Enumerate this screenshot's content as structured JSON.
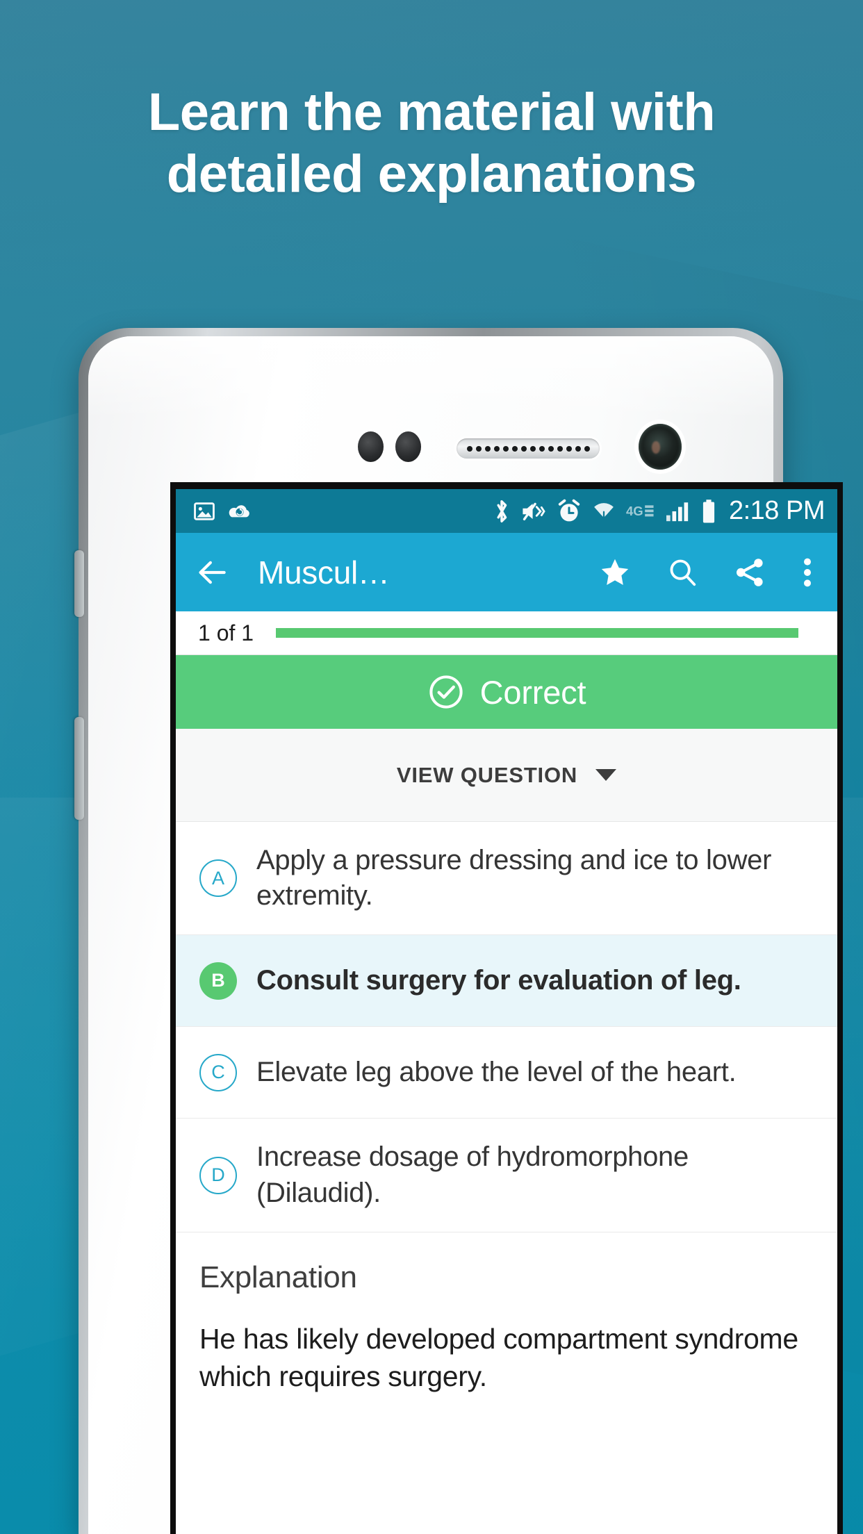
{
  "promo": {
    "headline_line1": "Learn the material with",
    "headline_line2": "detailed explanations",
    "background_color": "#1a7b99"
  },
  "device": {
    "name": "android-phone-mockup",
    "hardware": {
      "earpiece": "earpiece-speaker",
      "front_camera": "front-camera",
      "proximity_sensor": "proximity-sensor",
      "light_sensor": "light-sensor"
    }
  },
  "statusbar": {
    "left_icons": [
      "screenshot-icon",
      "cloud-sync-icon"
    ],
    "right_icons": [
      "bluetooth-icon",
      "volume-mute-icon",
      "alarm-icon",
      "wifi-icon",
      "4glte-icon",
      "signal-bars-icon",
      "battery-icon"
    ],
    "network_label": "4G",
    "time": "2:18 PM",
    "background_color": "#0d7a96"
  },
  "appbar": {
    "back_label": "back-arrow",
    "title": "Muscul…",
    "actions": [
      "star-icon",
      "search-icon",
      "share-icon",
      "overflow-menu-icon"
    ],
    "background_color": "#1ca8d2"
  },
  "progress": {
    "label": "1 of 1",
    "percent": 100,
    "fill_color": "#58c971"
  },
  "result_banner": {
    "text": "Correct",
    "icon": "check-circle-icon",
    "background_color": "#57cc7c"
  },
  "view_question": {
    "label": "VIEW QUESTION",
    "caret": "chevron-down-icon"
  },
  "options": [
    {
      "letter": "A",
      "text": "Apply a pressure dressing and ice to lower extremity.",
      "state": "normal"
    },
    {
      "letter": "B",
      "text": "Consult surgery for evaluation of leg.",
      "state": "correct"
    },
    {
      "letter": "C",
      "text": "Elevate leg above the level of the heart.",
      "state": "normal"
    },
    {
      "letter": "D",
      "text": "Increase dosage of hydromorphone (Dilaudid).",
      "state": "normal"
    }
  ],
  "explanation": {
    "title": "Explanation",
    "body": "He has likely developed compartment syndrome which requires surgery."
  },
  "colors": {
    "accent_teal": "#1ca8d2",
    "status_teal": "#0d7a96",
    "success_green": "#58c971",
    "correct_row_bg": "#e8f6fa",
    "badge_outline": "#26a8c9"
  }
}
